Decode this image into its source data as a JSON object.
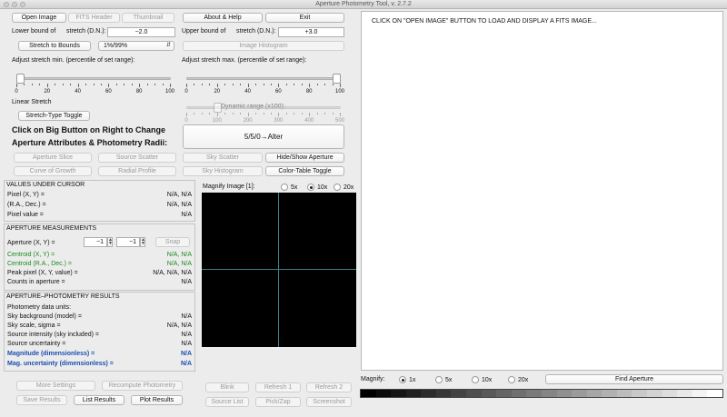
{
  "window": {
    "title": "Aperture Photometry Tool, v. 2.7.2"
  },
  "toolbar": {
    "open_image": "Open Image",
    "fits_header": "FITS Header",
    "thumbnail": "Thumbnail",
    "about_help": "About & Help",
    "exit": "Exit"
  },
  "stretch": {
    "lower_label": "Lower bound of",
    "lower_label2": "stretch (D.N.):",
    "lower_value": "−2.0",
    "upper_label": "Upper bound of",
    "upper_label2": "stretch (D.N.):",
    "upper_value": "+3.0",
    "to_bounds": "Stretch to Bounds",
    "range_select": "1%/99%",
    "image_histogram": "Image Histogram",
    "adjust_min_label": "Adjust stretch min. (percentile of set range):",
    "adjust_max_label": "Adjust stretch max. (percentile of set range):",
    "min_slider_ticks": [
      "0",
      "20",
      "40",
      "60",
      "80",
      "100"
    ],
    "max_slider_ticks": [
      "0",
      "20",
      "40",
      "60",
      "80",
      "100"
    ],
    "min_slider_value": 0,
    "max_slider_value": 100,
    "type_label": "Linear Stretch",
    "type_toggle": "Stretch-Type Toggle",
    "dynamic_range_label": "Dynamic range (x100):",
    "dynamic_ticks": [
      "0",
      "100",
      "200",
      "300",
      "400",
      "500"
    ],
    "dynamic_value": 100
  },
  "aperture": {
    "instruction_line1": "Click on Big Button on Right to Change",
    "instruction_line2": "Aperture Attributes & Photometry Radii:",
    "big_button": "5/5/0→Alter",
    "aperture_slice": "Aperture Slice",
    "source_scatter": "Source Scatter",
    "sky_scatter": "Sky Scatter",
    "hide_show": "Hide/Show Aperture",
    "curve_of_growth": "Curve of Growth",
    "radial_profile": "Radial Profile",
    "sky_histogram": "Sky Histogram",
    "color_table_toggle": "Color-Table Toggle"
  },
  "cursor_values": {
    "header": "VALUES UNDER CURSOR",
    "rows": [
      {
        "k": "Pixel (X, Y) =",
        "v": "N/A, N/A"
      },
      {
        "k": "(R.A., Dec.) =",
        "v": "N/A, N/A"
      },
      {
        "k": "Pixel value =",
        "v": "N/A"
      }
    ]
  },
  "measurements": {
    "header": "APERTURE MEASUREMENTS",
    "pos_label": "Aperture (X, Y) =",
    "x_value": "−1",
    "y_value": "−1",
    "snap": "Snap",
    "rows": [
      {
        "k": "Centroid (X, Y) =",
        "v": "N/A, N/A"
      },
      {
        "k": "Centroid (R.A., Dec.) =",
        "v": "N/A, N/A"
      },
      {
        "k": "Peak pixel (X, Y, value) =",
        "v": "N/A, N/A, N/A"
      },
      {
        "k": "Counts in aperture =",
        "v": "N/A"
      }
    ]
  },
  "photometry": {
    "header": "APERTURE–PHOTOMETRY RESULTS",
    "rows": [
      {
        "k": "Photometry data units:",
        "v": ""
      },
      {
        "k": "Sky background (model) =",
        "v": "N/A"
      },
      {
        "k": "Sky scale, sigma =",
        "v": "N/A, N/A"
      },
      {
        "k": "Source intensity (sky included) =",
        "v": "N/A"
      },
      {
        "k": "Source uncertainty =",
        "v": "N/A"
      },
      {
        "k": "Magnitude (dimensionless) =",
        "v": "N/A"
      },
      {
        "k": "Mag. uncertainty (dimensionless) =",
        "v": "N/A"
      }
    ]
  },
  "magnify_small": {
    "label": "Magnify Image [1]:",
    "options": [
      "5x",
      "10x",
      "20x"
    ],
    "selected": "10x"
  },
  "bottom": {
    "more_settings": "More Settings",
    "recompute": "Recompute Photometry",
    "blink": "Blink",
    "refresh1": "Refresh 1",
    "refresh2": "Refresh 2",
    "save_results": "Save Results",
    "list_results": "List Results",
    "plot_results": "Plot Results",
    "source_list": "Source List",
    "pick_zap": "Pick/Zap",
    "screenshot": "Screenshot"
  },
  "display": {
    "message": "CLICK ON \"OPEN IMAGE\" BUTTON TO LOAD AND DISPLAY A FITS IMAGE..."
  },
  "magnify_main": {
    "label": "Magnify:",
    "options": [
      "1x",
      "5x",
      "10x",
      "20x"
    ],
    "selected": "1x",
    "find_aperture": "Find Aperture"
  },
  "colors": {
    "green_text": "#1b8a1b",
    "blue_text": "#1c4fb0",
    "crosshair": "#3c7f8f"
  }
}
